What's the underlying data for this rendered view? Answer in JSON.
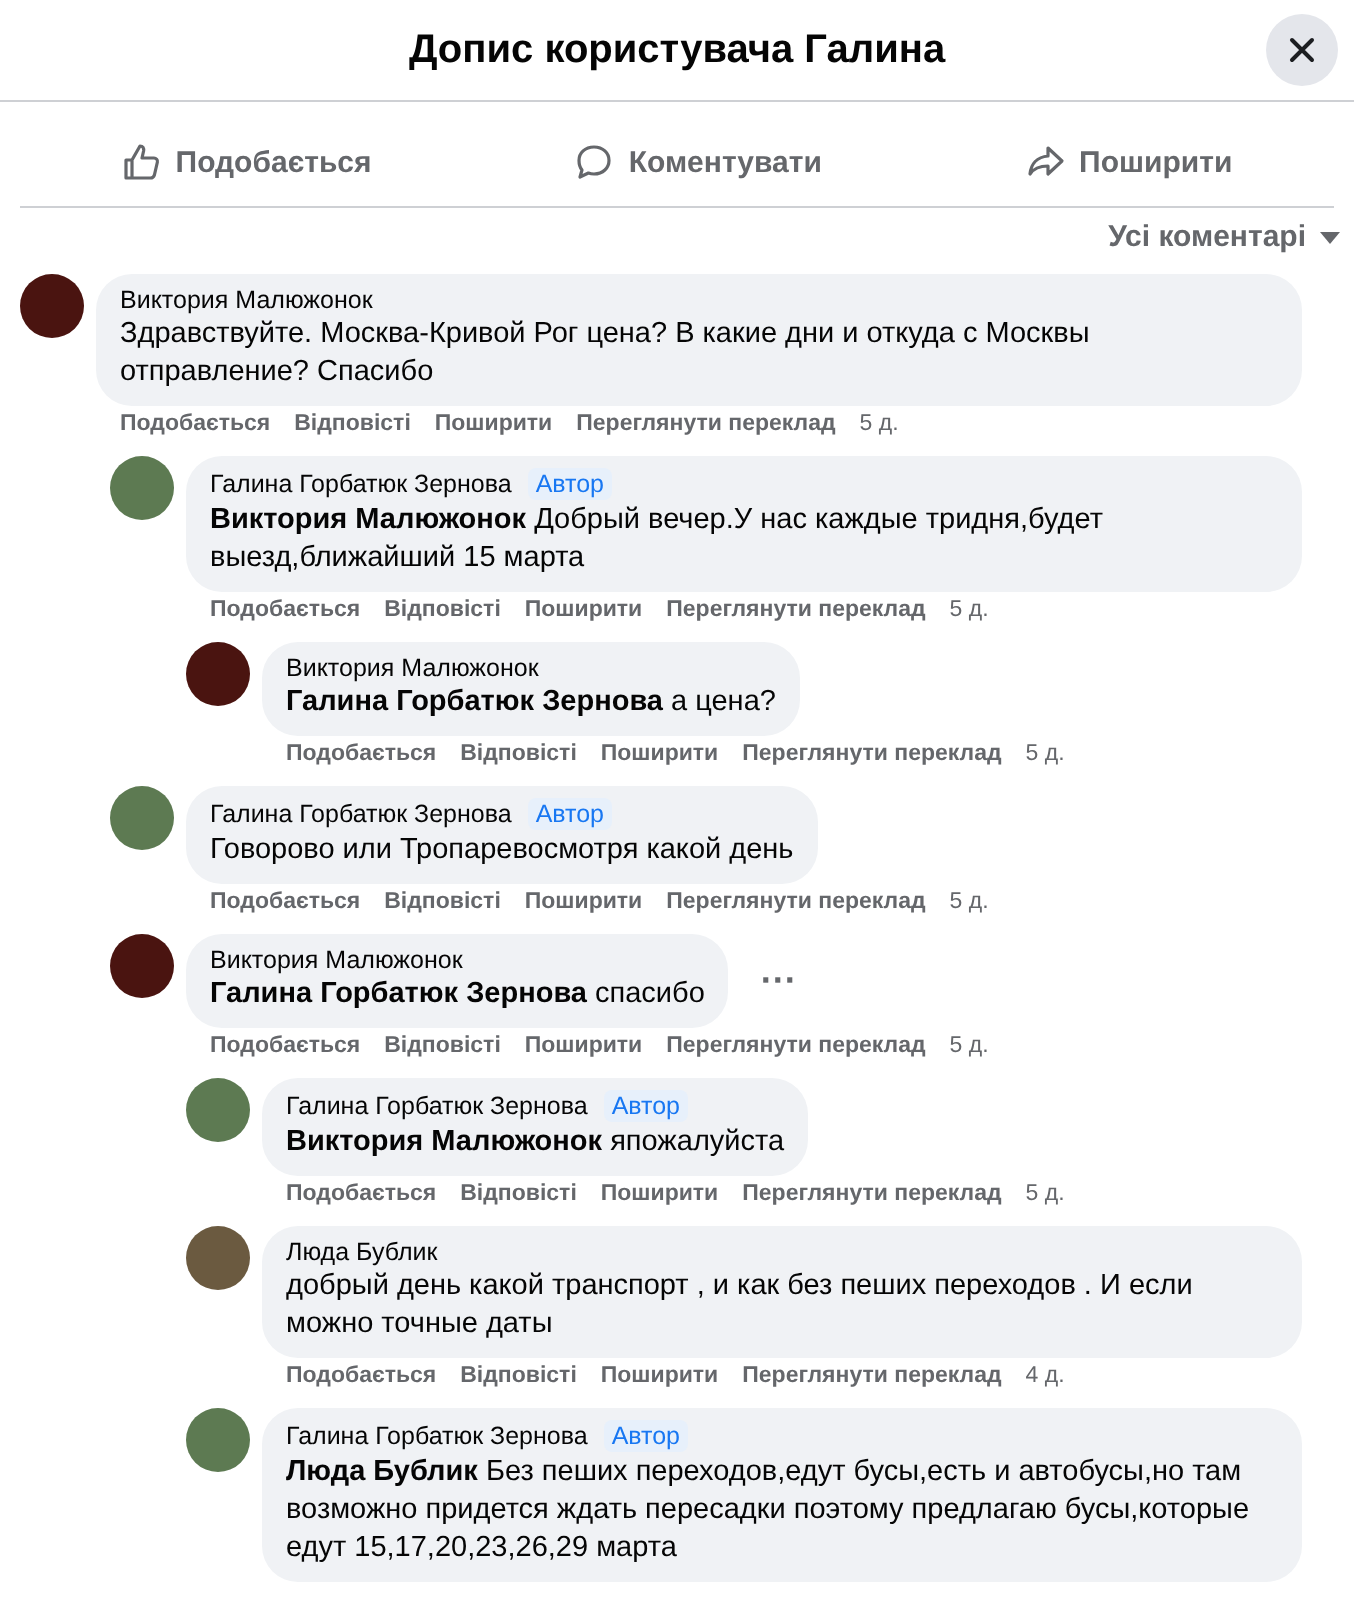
{
  "dialog": {
    "title": "Допис користувача Галина"
  },
  "actions": [
    {
      "kind": "like",
      "label": "Подобається"
    },
    {
      "kind": "comment",
      "label": "Коментувати"
    },
    {
      "kind": "share",
      "label": "Поширити"
    }
  ],
  "sort": {
    "label": "Усі коментарі"
  },
  "comments": [
    {
      "author": "Виктория Малюжонок",
      "color": "#4a1410",
      "text": "Здравствуйте. Москва-Кривой Рог цена? В какие дни и откуда с Москвы отправление? Спасибо",
      "links": [
        "Подобається",
        "Відповісті",
        "Поширити",
        "Переглянути переклад"
      ],
      "time": "5 д.",
      "children": [
        {
          "author": "Галина Горбатюк Зернова",
          "badge": "Автор",
          "color": "#5d7a52",
          "text": "**Виктория Малюжонок** Добрый вечер.У нас каждые тридня,будет выезд,ближайший 15 марта",
          "links": [
            "Подобається",
            "Відповісті",
            "Поширити",
            "Переглянути переклад"
          ],
          "time": "5 д.",
          "children": [
            {
              "author": "Виктория Малюжонок",
              "color": "#4a1410",
              "text": "**Галина Горбатюк Зернова** а цена?",
              "links": [
                "Подобається",
                "Відповісті",
                "Поширити",
                "Переглянути переклад"
              ],
              "time": "5 д."
            }
          ]
        },
        {
          "author": "Галина Горбатюк Зернова",
          "badge": "Автор",
          "color": "#5d7a52",
          "text": "Говорово или Тропаревосмотря какой день",
          "links": [
            "Подобається",
            "Відповісті",
            "Поширити",
            "Переглянути переклад"
          ],
          "time": "5 д."
        },
        {
          "author": "Виктория Малюжонок",
          "color": "#4a1410",
          "more": "···",
          "text": "**Галина Горбатюк Зернова** спасибо",
          "links": [
            "Подобається",
            "Відповісті",
            "Поширити",
            "Переглянути переклад"
          ],
          "time": "5 д.",
          "children": [
            {
              "author": "Галина Горбатюк Зернова",
              "badge": "Автор",
              "color": "#5d7a52",
              "text": "**Виктория Малюжонок** япожалуйста",
              "links": [
                "Подобається",
                "Відповісті",
                "Поширити",
                "Переглянути переклад"
              ],
              "time": "5 д."
            },
            {
              "author": "Люда Бублик",
              "color": "#6b5a40",
              "text": "добрый день какой транспорт , и как без пеших переходов . И если можно точные даты",
              "links": [
                "Подобається",
                "Відповісті",
                "Поширити",
                "Переглянути переклад"
              ],
              "time": "4 д."
            },
            {
              "author": "Галина Горбатюк Зернова",
              "badge": "Автор",
              "color": "#5d7a52",
              "text": "**Люда Бублик** Без пеших переходов,едут бусы,есть и автобусы,но там возможно придется ждать пересадки поэтому предлагаю бусы,которые едут 15,17,20,23,26,29 марта"
            }
          ]
        }
      ]
    }
  ]
}
